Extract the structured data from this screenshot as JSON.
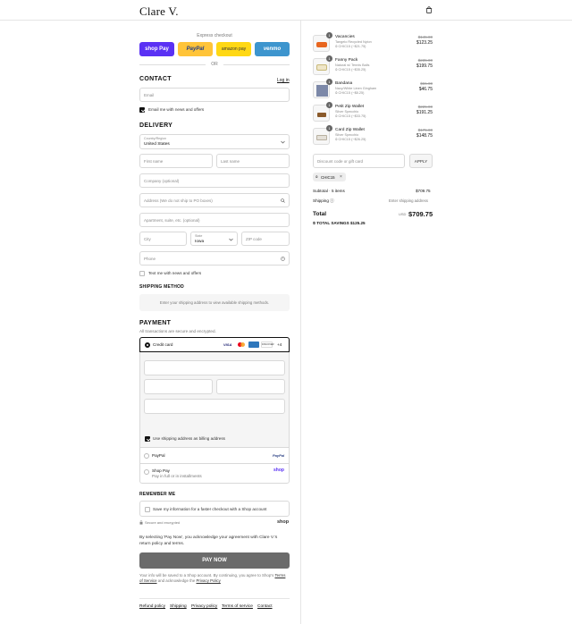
{
  "header": {
    "logo": "Clare V.",
    "cart_icon": "shopping-bag-icon"
  },
  "express": {
    "label": "Express checkout",
    "buttons": [
      {
        "label": "shop Pay",
        "color": "#5a31f4"
      },
      {
        "label": "PayPal",
        "color": "#ffc439"
      },
      {
        "label": "amazon pay",
        "color": "#ffd814"
      },
      {
        "label": "venmo",
        "color": "#3d95ce"
      }
    ],
    "or": "OR"
  },
  "contact": {
    "heading": "CONTACT",
    "login": "Log in",
    "email_placeholder": "Email",
    "news_label": "Email me with news and offers"
  },
  "delivery": {
    "heading": "DELIVERY",
    "country_label": "Country/Region",
    "country_value": "United States",
    "first_name": "First name",
    "last_name": "Last name",
    "company": "Company (optional)",
    "address": "Address (We do not ship to PO boxes)",
    "apartment": "Apartment, suite, etc. (optional)",
    "city": "City",
    "state_label": "State",
    "state_value": "Iowa",
    "zip": "ZIP code",
    "phone": "Phone",
    "text_news": "Text me with news and offers"
  },
  "shipping": {
    "heading": "SHIPPING METHOD",
    "message": "Enter your shipping address to view available shipping methods."
  },
  "payment": {
    "heading": "PAYMENT",
    "note": "All transactions are secure and encrypted.",
    "credit_card": "Credit card",
    "more_cards": "+4",
    "billing_same": "Use shipping address as billing address",
    "paypal": "PayPal",
    "paypal_logo": "PayPal",
    "shop_pay": "Shop Pay",
    "shop_pay_sub": "Pay in full or in installments",
    "shop_logo": "shop"
  },
  "remember": {
    "heading": "REMEMBER ME",
    "save_label": "Save my information for a faster checkout with a Shop account",
    "secure": "Secure and encrypted",
    "shop_logo": "shop"
  },
  "legal": {
    "agreement": "By selecting 'Pay Now', you acknowledge your agreement with Clare V.'s return policy and terms.",
    "pay_now": "PAY NOW",
    "shop_note_1": "Your info will be saved to a Shop account. By continuing, you agree to Shop's",
    "terms": "Terms of Service",
    "and_ack": "and acknowledge the",
    "privacy": "Privacy Policy"
  },
  "footer": {
    "links": [
      "Refund policy",
      "Shipping",
      "Privacy policy",
      "Terms of service",
      "Contact"
    ]
  },
  "cart": {
    "items": [
      {
        "qty": "1",
        "name": "Vacancies",
        "variant": "Tangelo Recycled Nylon",
        "code": "CHIC15 (−$21.75)",
        "old": "$145.00",
        "new": "$123.25"
      },
      {
        "qty": "1",
        "name": "Fanny Pack",
        "variant": "Natural w/ Tennis Balls",
        "code": "CHIC15 (−$35.25)",
        "old": "$235.00",
        "new": "$199.75"
      },
      {
        "qty": "1",
        "name": "Bandana",
        "variant": "Navy/White Linen Gingham",
        "code": "CHIC15 (−$8.25)",
        "old": "$55.00",
        "new": "$46.75"
      },
      {
        "qty": "1",
        "name": "Petit Zip Wallet",
        "variant": "Silver Specchio",
        "code": "CHIC15 (−$33.75)",
        "old": "$225.00",
        "new": "$191.25"
      },
      {
        "qty": "1",
        "name": "Card Zip Wallet",
        "variant": "Silver Specchio",
        "code": "CHIC15 (−$26.25)",
        "old": "$175.00",
        "new": "$148.75"
      }
    ],
    "discount_placeholder": "Discount code or gift card",
    "apply": "APPLY",
    "applied_code": "CHIC15",
    "subtotal_label": "Subtotal · 5 items",
    "subtotal_value": "$709.75",
    "shipping_label": "Shipping",
    "shipping_value": "Enter shipping address",
    "total_label": "Total",
    "currency": "USD",
    "total_value": "$709.75",
    "savings_label": "TOTAL SAVINGS",
    "savings_value": "$125.25"
  }
}
